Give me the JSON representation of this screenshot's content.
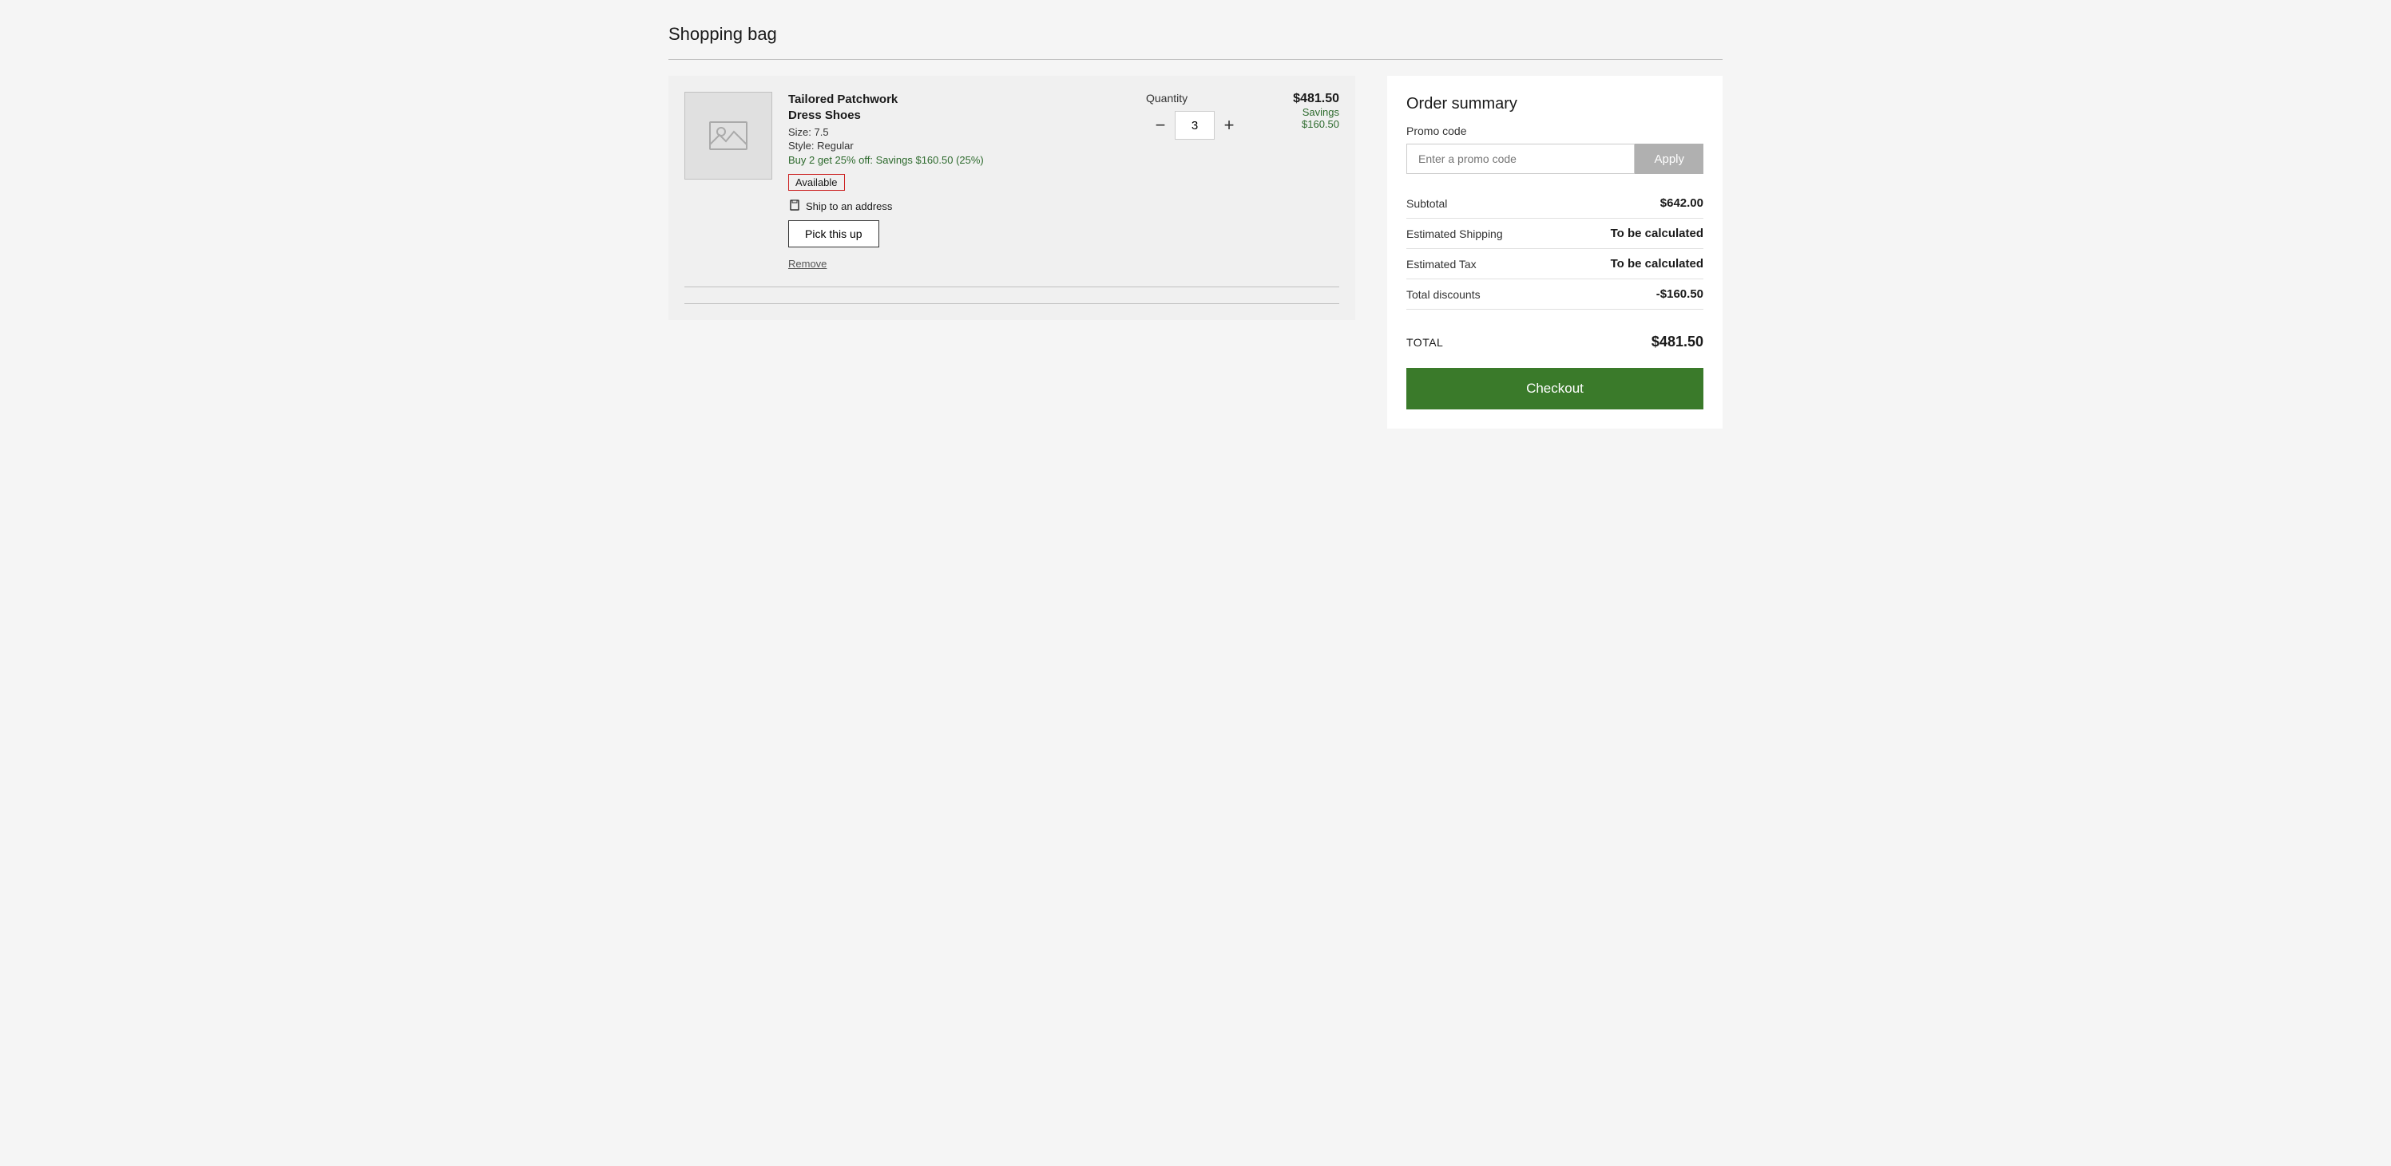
{
  "page": {
    "title": "Shopping bag"
  },
  "cart": {
    "item": {
      "name_line1": "Tailored Patchwork",
      "name_line2": "Dress Shoes",
      "size": "Size: 7.5",
      "style": "Style: Regular",
      "promo": "Buy 2 get 25% off: Savings $160.50 (25%)",
      "availability": "Available",
      "ship_option": "Ship to an address",
      "pickup_label": "Pick this up",
      "remove_label": "Remove",
      "quantity_label": "Quantity",
      "quantity_value": "3",
      "price": "$481.50",
      "savings_label": "Savings",
      "savings_amount": "$160.50"
    }
  },
  "order_summary": {
    "title": "Order summary",
    "promo_code_label": "Promo code",
    "promo_placeholder": "Enter a promo code",
    "apply_button": "Apply",
    "rows": [
      {
        "label": "Subtotal",
        "value": "$642.00"
      },
      {
        "label": "Estimated Shipping",
        "value": "To be calculated"
      },
      {
        "label": "Estimated Tax",
        "value": "To be calculated"
      },
      {
        "label": "Total discounts",
        "value": "-$160.50"
      }
    ],
    "total_label": "TOTAL",
    "total_value": "$481.50",
    "checkout_button": "Checkout"
  },
  "icons": {
    "image_placeholder": "🖼",
    "ship": "🗑"
  }
}
